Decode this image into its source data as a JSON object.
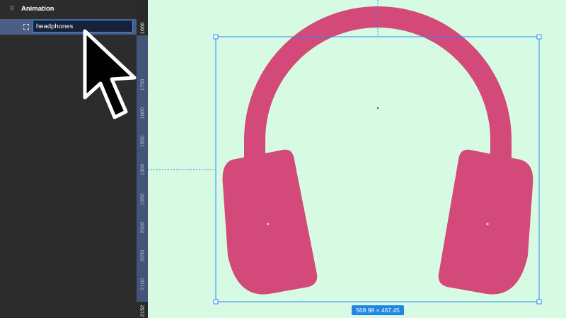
{
  "layers_panel": {
    "frame": {
      "icon": "frame-hash-icon",
      "label": "Animation"
    },
    "selected_layer": {
      "icon": "frame-grid-icon",
      "name": "headphones"
    }
  },
  "ruler": {
    "ticks": [
      "1666",
      "1750",
      "1800",
      "1850",
      "1900",
      "1950",
      "2000",
      "2050",
      "2100",
      "2152"
    ]
  },
  "canvas": {
    "background": "#d6fbe2",
    "selection_color": "#2a8bf5",
    "object_color": "#d34a7a",
    "dimensions_label": "568.98 × 467.45"
  }
}
